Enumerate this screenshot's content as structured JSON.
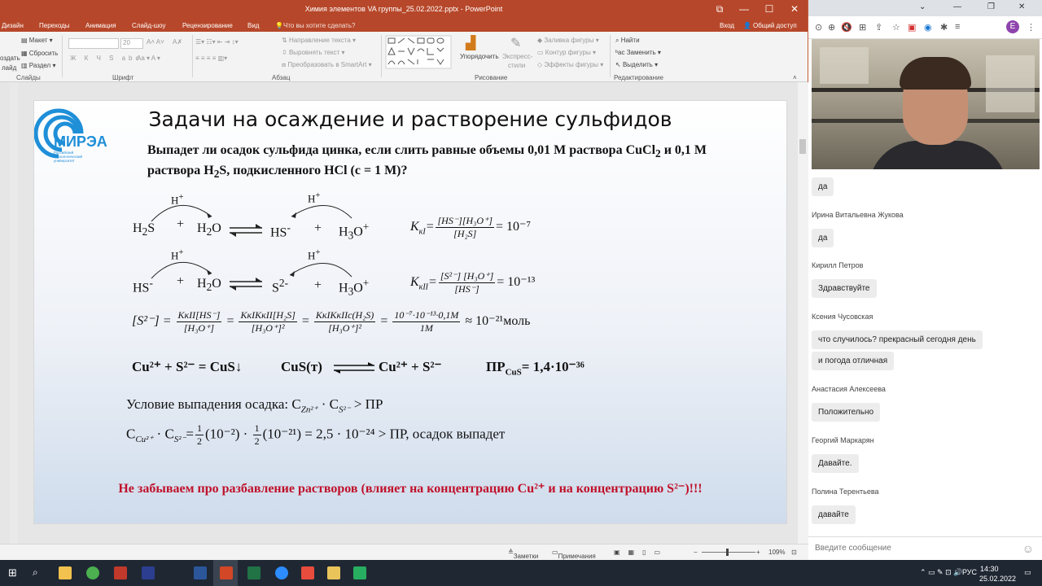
{
  "ppt": {
    "title": "Химия элементов VA группы_25.02.2022.pptx - PowerPoint",
    "tabs": [
      "Дизайн",
      "Переходы",
      "Анимация",
      "Слайд-шоу",
      "Рецензирование",
      "Вид"
    ],
    "tell_me": "Что вы хотите сделать?",
    "signin": "Вход",
    "share": "Общий доступ",
    "ribbon": {
      "slides_group": {
        "create": "оздать",
        "slide": "лайд",
        "layout": "Макет",
        "reset": "Сбросить",
        "section": "Раздел",
        "label": "Слайды"
      },
      "font_group": {
        "size": "20",
        "label": "Шрифт"
      },
      "paragraph_group": {
        "text_dir": "Направление текста",
        "align_text": "Выровнять текст",
        "smartart": "Преобразовать в SmartArt",
        "label": "Абзац"
      },
      "drawing_group": {
        "arrange": "Упорядочить",
        "express": "Экспресс-",
        "styles": "стили",
        "fill": "Заливка фигуры",
        "outline": "Контур фигуры",
        "effects": "Эффекты фигуры",
        "label": "Рисование"
      },
      "editing_group": {
        "find": "Найти",
        "replace": "Заменить",
        "select": "Выделить",
        "label": "Редактирование"
      }
    },
    "status": {
      "notes": "Заметки",
      "comments": "Примечания",
      "zoom": "109%"
    }
  },
  "slide": {
    "logo": {
      "name": "МИРЭА",
      "sub": "Российский технологический университет"
    },
    "title": "Задачи на осаждение и растворение сульфидов",
    "question_1": "Выпадет ли осадок сульфида цинка, если слить равные объемы 0,01 М раствора CuCl",
    "question_1b": "2",
    "question_1c": " и 0,1 М",
    "question_2a": "раствора H",
    "question_2b": "2",
    "question_2c": "S, подкисленного HCl (с = 1 М)?",
    "eq1_h": "H+",
    "eq1_left": "H2S",
    "eq1_plus": "+",
    "eq1_water": "H2O",
    "eq1_right1": "HS-",
    "eq1_right2": "H3O+",
    "k1_label": "K",
    "k1_sub": "кI",
    "k1_num": "[HS⁻][H₃O⁺]",
    "k1_den": "[H₂S]",
    "k1_val": "= 10⁻⁷",
    "eq2_left": "HS-",
    "eq2_right1": "S2-",
    "k2_sub": "кII",
    "k2_num": "[S²⁻] [H₃O⁺]",
    "k2_den": "[HS⁻]",
    "k2_val": "= 10⁻¹³",
    "s2_lhs": "[S²⁻] =",
    "s2_f1_num": "KкII[HS⁻]",
    "s2_f1_den": "[H₃O⁺]",
    "s2_f2_num": "KкIKкII[H₂S]",
    "s2_f2_den": "[H₃O⁺]²",
    "s2_f3_num": "KкIKкIIc(H₂S)",
    "s2_f3_den": "[H₃O⁺]²",
    "s2_f4_num": "10⁻⁷·10⁻¹³·0,1M",
    "s2_f4_den": "1M",
    "s2_result": "≈ 10⁻²¹моль",
    "rxn1": "Cu²⁺ + S²⁻ = CuS↓",
    "rxn2_left": "CuS(т)",
    "rxn2_right": "Cu²⁺ + S²⁻",
    "pr": "ПР",
    "pr_sub": "CuS",
    "pr_val": "= 1,4·10⁻³⁶",
    "cond_1": "Условие выпадения осадка: C",
    "cond_1_sub": "Zn²⁺",
    "cond_1_b": " · C",
    "cond_1_sub2": "S²⁻",
    "cond_1_c": " > ПР",
    "cond_2": "C",
    "cond_2_sub": "Cu²⁺",
    "cond_2_b": " · C",
    "cond_2_sub2": "S²⁻",
    "cond_2_c": "=",
    "cond_2_half": "1",
    "cond_2_two": "2",
    "cond_2_p1": "(10⁻²) ·",
    "cond_2_p2": "(10⁻²¹) = 2,5 · 10⁻²⁴ > ПР, осадок выпадет",
    "note": "Не забываем про разбавление растворов (влияет на концентрацию Cu²⁺ и на концентрацию S²⁻)!!!"
  },
  "browser": {
    "avatar_letter": "E"
  },
  "chat": {
    "messages": [
      {
        "author": "",
        "text": "да"
      },
      {
        "author": "Ирина Витальевна Жукова",
        "text": "да"
      },
      {
        "author": "Кирилл Петров",
        "text": "Здравствуйте"
      },
      {
        "author": "Ксения Чусовская",
        "text": "что случилось? прекрасный сегодня день"
      },
      {
        "author": "",
        "text": "и погода отличная"
      },
      {
        "author": "Анастасия Алексеева",
        "text": "Положительно"
      },
      {
        "author": "Георгий Маркарян",
        "text": "Давайте."
      },
      {
        "author": "Полина Терентьева",
        "text": "давайте"
      }
    ],
    "input_placeholder": "Введите сообщение"
  },
  "taskbar": {
    "lang": "РУС",
    "time": "14:30",
    "date": "25.02.2022"
  }
}
